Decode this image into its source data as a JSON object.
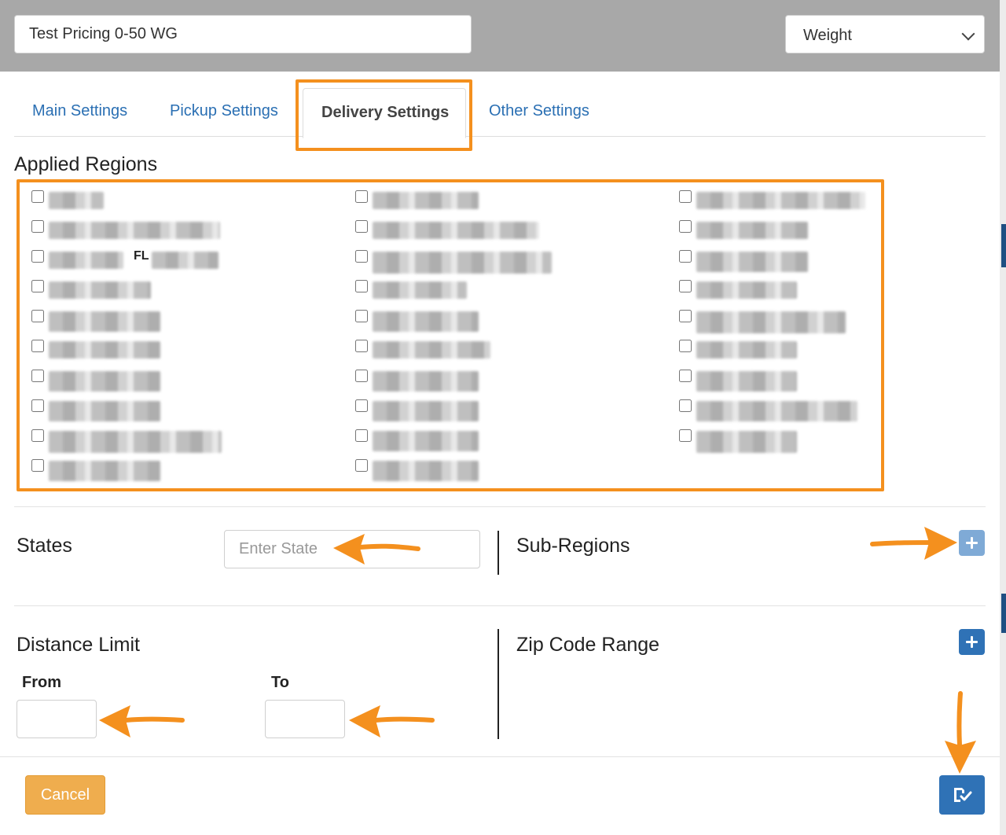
{
  "header": {
    "title_value": "Test Pricing 0-50 WG",
    "type_value": "Weight"
  },
  "tabs": [
    {
      "label": "Main Settings"
    },
    {
      "label": "Pickup Settings"
    },
    {
      "label": "Delivery Settings"
    },
    {
      "label": "Other Settings"
    }
  ],
  "regions": {
    "heading": "Applied Regions",
    "visible_text": "FL"
  },
  "states": {
    "label": "States",
    "placeholder": "Enter State"
  },
  "sub_regions": {
    "label": "Sub-Regions"
  },
  "distance": {
    "label": "Distance Limit",
    "from_label": "From",
    "to_label": "To"
  },
  "zip": {
    "label": "Zip Code Range"
  },
  "footer": {
    "cancel_label": "Cancel"
  },
  "colors": {
    "highlight": "#f4901e",
    "primary": "#2f72b6",
    "cancel": "#efad4e",
    "header_bg": "#a8a8a8",
    "tab_link": "#2a6fb3"
  }
}
